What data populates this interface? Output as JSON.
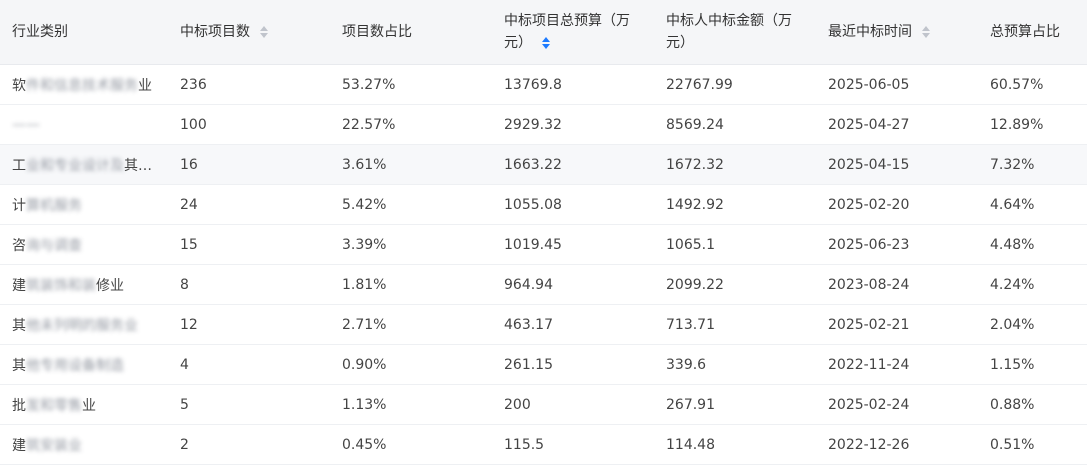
{
  "headers": {
    "industry": "行业类别",
    "count": "中标项目数",
    "count_ratio": "项目数占比",
    "budget": "中标项目总预算（万元）",
    "amount": "中标人中标金额（万元）",
    "latest": "最近中标时间",
    "budget_ratio": "总预算占比"
  },
  "rows": [
    {
      "industry_visible": "软",
      "industry_blur": "件和信息技术服务",
      "industry_tail": "业",
      "count": "236",
      "count_ratio": "53.27%",
      "budget": "13769.8",
      "amount": "22767.99",
      "latest": "2025-06-05",
      "budget_ratio": "60.57%"
    },
    {
      "industry_visible": "",
      "industry_blur": "——",
      "industry_tail": "",
      "count": "100",
      "count_ratio": "22.57%",
      "budget": "2929.32",
      "amount": "8569.24",
      "latest": "2025-04-27",
      "budget_ratio": "12.89%"
    },
    {
      "industry_visible": "工",
      "industry_blur": "业和专业设计及",
      "industry_tail": "其…",
      "count": "16",
      "count_ratio": "3.61%",
      "budget": "1663.22",
      "amount": "1672.32",
      "latest": "2025-04-15",
      "budget_ratio": "7.32%"
    },
    {
      "industry_visible": "计",
      "industry_blur": "算机服务",
      "industry_tail": "",
      "count": "24",
      "count_ratio": "5.42%",
      "budget": "1055.08",
      "amount": "1492.92",
      "latest": "2025-02-20",
      "budget_ratio": "4.64%"
    },
    {
      "industry_visible": "咨",
      "industry_blur": "询与调查",
      "industry_tail": "",
      "count": "15",
      "count_ratio": "3.39%",
      "budget": "1019.45",
      "amount": "1065.1",
      "latest": "2025-06-23",
      "budget_ratio": "4.48%"
    },
    {
      "industry_visible": "建",
      "industry_blur": "筑装饰和装",
      "industry_tail": "修业",
      "count": "8",
      "count_ratio": "1.81%",
      "budget": "964.94",
      "amount": "2099.22",
      "latest": "2023-08-24",
      "budget_ratio": "4.24%"
    },
    {
      "industry_visible": "其",
      "industry_blur": "他未列明的服务业",
      "industry_tail": "",
      "count": "12",
      "count_ratio": "2.71%",
      "budget": "463.17",
      "amount": "713.71",
      "latest": "2025-02-21",
      "budget_ratio": "2.04%"
    },
    {
      "industry_visible": "其",
      "industry_blur": "他专用设备制造",
      "industry_tail": "",
      "count": "4",
      "count_ratio": "0.90%",
      "budget": "261.15",
      "amount": "339.6",
      "latest": "2022-11-24",
      "budget_ratio": "1.15%"
    },
    {
      "industry_visible": "批",
      "industry_blur": "发和零售",
      "industry_tail": "业",
      "count": "5",
      "count_ratio": "1.13%",
      "budget": "200",
      "amount": "267.91",
      "latest": "2025-02-24",
      "budget_ratio": "0.88%"
    },
    {
      "industry_visible": "建",
      "industry_blur": "筑安装业",
      "industry_tail": "",
      "count": "2",
      "count_ratio": "0.45%",
      "budget": "115.5",
      "amount": "114.48",
      "latest": "2022-12-26",
      "budget_ratio": "0.51%"
    }
  ],
  "colors": {
    "header_bg": "#f5f6f8",
    "active_sort": "#1e7bff",
    "inactive_sort": "#c0c4cc",
    "hover_row": "#f7f8fa"
  },
  "state": {
    "hovered_row_index": 2,
    "active_sort_column": "budget",
    "active_sort_direction": "desc"
  }
}
